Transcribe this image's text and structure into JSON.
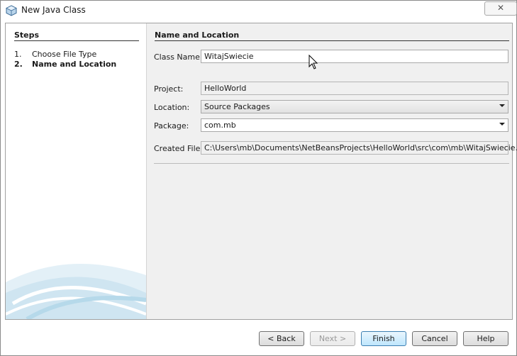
{
  "window": {
    "title": "New Java Class",
    "close_label": "✕"
  },
  "steps": {
    "title": "Steps",
    "items": [
      {
        "num": "1.",
        "label": "Choose File Type"
      },
      {
        "num": "2.",
        "label": "Name and Location"
      }
    ],
    "current_index": 1
  },
  "main": {
    "title": "Name and Location",
    "class_name": {
      "label": "Class Name:",
      "value": "WitajSwiecie"
    },
    "project": {
      "label": "Project:",
      "value": "HelloWorld"
    },
    "location": {
      "label": "Location:",
      "value": "Source Packages"
    },
    "package": {
      "label": "Package:",
      "value": "com.mb"
    },
    "created_file": {
      "label": "Created File:",
      "value": "C:\\Users\\mb\\Documents\\NetBeansProjects\\HelloWorld\\src\\com\\mb\\WitajSwiecie.java"
    }
  },
  "buttons": {
    "back": "< Back",
    "next": "Next >",
    "finish": "Finish",
    "cancel": "Cancel",
    "help": "Help"
  },
  "colors": {
    "accent": "#3c7fb1",
    "panel": "#f0f0f0",
    "decor": "#c9e3f0"
  }
}
